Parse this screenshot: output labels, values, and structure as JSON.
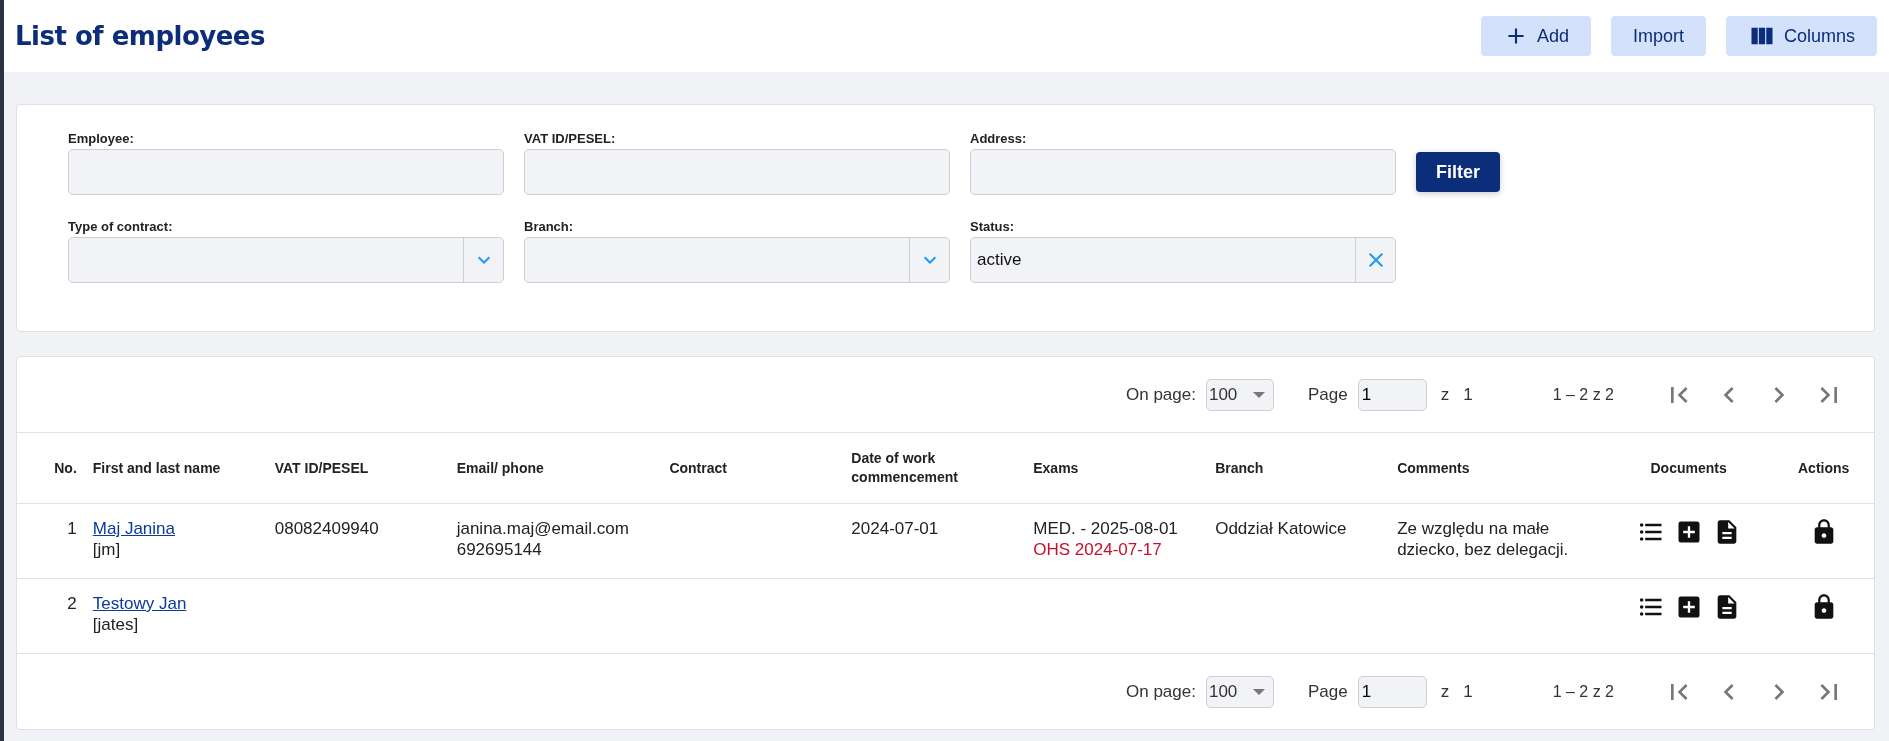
{
  "header": {
    "title": "List of employees",
    "buttons": [
      {
        "kind": "add",
        "label": "Add"
      },
      {
        "kind": "plain",
        "label": "Import"
      },
      {
        "kind": "columns",
        "label": "Columns"
      }
    ]
  },
  "filters": {
    "fields": [
      {
        "kind": "text",
        "label": "Employee:"
      },
      {
        "kind": "text",
        "label": "VAT ID/PESEL:"
      },
      {
        "kind": "text",
        "label": "Address:"
      },
      {
        "kind": "select",
        "label": "Type of contract:"
      },
      {
        "kind": "select",
        "label": "Branch:"
      },
      {
        "kind": "clearable",
        "label": "Status:",
        "value": "active"
      }
    ],
    "button": "Filter"
  },
  "pagination_top": {
    "per_page_label": "On page:",
    "per_page": "100",
    "page_label": "Page",
    "page": "1",
    "of": "z",
    "pages": "1",
    "range": "1 – 2 z 2"
  },
  "table": {
    "columns": [
      "No.",
      "First and last name",
      "VAT ID/PESEL",
      "Email/ phone",
      "Contract",
      "Date of work commencement",
      "Exams",
      "Branch",
      "Comments",
      "Documents",
      "Actions"
    ],
    "rows": [
      {
        "no": "1",
        "name": "Maj Janina",
        "login": "[jm]",
        "vat": "08082409940",
        "email": "janina.maj@email.com",
        "phone": "692695144",
        "date": "2024-07-01",
        "exams": [
          {
            "text": "MED. - 2025-08-01",
            "overdue": false
          },
          {
            "text": "OHS 2024-07-17",
            "overdue": true
          }
        ],
        "branch": "Oddział Katowice",
        "comments": "Ze względu na małe dziecko, bez delegacji."
      },
      {
        "no": "2",
        "name": "Testowy Jan",
        "login": "[jates]",
        "exams": []
      }
    ]
  },
  "pagination_bottom": {
    "per_page_label": "On page:",
    "per_page": "100",
    "page_label": "Page",
    "page": "1",
    "of": "z",
    "pages": "1",
    "range": "1 – 2 z 2"
  }
}
